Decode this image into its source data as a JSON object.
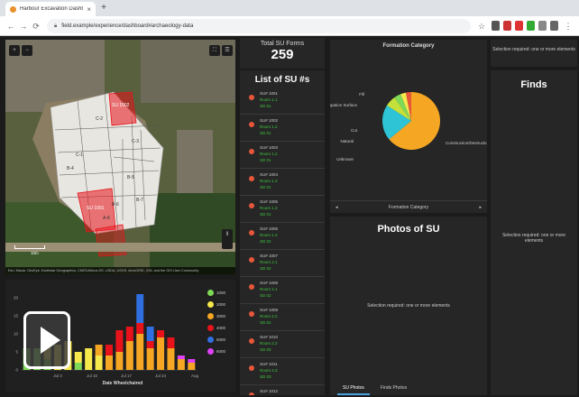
{
  "browser": {
    "tab_title": "Harbour Excavation Dashboard",
    "tab_close": "×",
    "new_tab": "+",
    "url": "field.example/experience/dashboard#archaeology-data",
    "back": "←",
    "forward": "→",
    "reload": "⟳",
    "star": "☆"
  },
  "map": {
    "zoom_in": "+",
    "zoom_out": "−",
    "layers": "☰",
    "attribution": "Esri, Maxar, GeoEye, Earthstar Geographics, CNES/Airbus DS, USDA, USGS, AeroGRID, IGN, and the GIS User Community",
    "scale_label": "10m",
    "polygon_labels": [
      "C-1",
      "C-2",
      "C-3",
      "B-4",
      "B-5",
      "B-6",
      "B-7",
      "A-8"
    ],
    "highlight_labels": [
      "SU 1001",
      "SU 1002"
    ]
  },
  "total": {
    "label": "Total SU Forms",
    "value": "259"
  },
  "su_list": {
    "title": "List of SU #s",
    "items": [
      {
        "su": "SU# 1001",
        "line1": "Room 1.1",
        "line2": "SD 01"
      },
      {
        "su": "SU# 1002",
        "line1": "Room 1.2",
        "line2": "SD 01"
      },
      {
        "su": "SU# 1003",
        "line1": "Room 1.2",
        "line2": "SD 01"
      },
      {
        "su": "SU# 1004",
        "line1": "Room 1.3",
        "line2": "SD 01"
      },
      {
        "su": "SU# 1005",
        "line1": "Room 1.3",
        "line2": "SD 01"
      },
      {
        "su": "SU# 1006",
        "line1": "Room 1.3",
        "line2": "SD 02"
      },
      {
        "su": "SU# 1007",
        "line1": "Room 2.1",
        "line2": "SD 02"
      },
      {
        "su": "SU# 1008",
        "line1": "Room 2.1",
        "line2": "SD 02"
      },
      {
        "su": "SU# 1009",
        "line1": "Room 2.2",
        "line2": "SD 02"
      },
      {
        "su": "SU# 1010",
        "line1": "Room 2.2",
        "line2": "SD 03"
      },
      {
        "su": "SU# 1011",
        "line1": "Room 2.3",
        "line2": "SD 03"
      },
      {
        "su": "SU# 1012",
        "line1": "Room 2.3",
        "line2": "SD 03"
      }
    ]
  },
  "pie": {
    "title": "Formation Category",
    "footer": "Formation Category",
    "prev": "◂",
    "next": "▸",
    "labels": [
      "Fill",
      "Occupation Surface",
      "Cut",
      "Natural",
      "Construction/Destruction",
      "Unknown"
    ],
    "slices": [
      {
        "name": "Construction/Destruction",
        "value": 64,
        "color": "#f5a623"
      },
      {
        "name": "Fill",
        "value": 20,
        "color": "#2ec4d6"
      },
      {
        "name": "Occupation Surface",
        "value": 6,
        "color": "#c6e03a"
      },
      {
        "name": "Cut",
        "value": 4,
        "color": "#7ed957"
      },
      {
        "name": "Natural",
        "value": 3,
        "color": "#f7e94b"
      },
      {
        "name": "Unknown",
        "value": 3,
        "color": "#e8563a"
      }
    ]
  },
  "photos": {
    "title": "Photos of SU",
    "message": "Selection required: one or more elements",
    "tabs": [
      "SU Photos",
      "Finds Photos"
    ]
  },
  "selection_top": {
    "message": "Selection required: one or more elements"
  },
  "finds": {
    "title": "Finds",
    "message": "Selection required: one or more elements"
  },
  "timechart": {
    "xlabel": "Date Wheelchaired",
    "xticks": [
      "Jul 3",
      "Jul 10",
      "Jul 17",
      "Jul 24",
      "Aug"
    ],
    "yticks": [
      "0",
      "5",
      "10",
      "15",
      "20"
    ],
    "legend": [
      {
        "label": "1000",
        "color": "#7ed957"
      },
      {
        "label": "2000",
        "color": "#f7e94b"
      },
      {
        "label": "3000",
        "color": "#f5a623"
      },
      {
        "label": "4000",
        "color": "#e8131a"
      },
      {
        "label": "5000",
        "color": "#2f6fe0"
      },
      {
        "label": "6000",
        "color": "#e040fb"
      }
    ]
  },
  "chart_data": {
    "type": "bar",
    "stacked": true,
    "xlabel": "Date Wheelchaired",
    "ylim": [
      0,
      22
    ],
    "series": [
      {
        "name": "1000",
        "values": [
          6,
          6,
          3,
          0,
          0,
          2,
          0,
          0,
          0,
          0,
          0,
          0,
          0,
          0,
          0,
          0,
          0
        ]
      },
      {
        "name": "2000",
        "values": [
          0,
          0,
          5,
          7,
          8,
          3,
          6,
          4,
          0,
          0,
          0,
          0,
          0,
          0,
          0,
          0,
          0
        ]
      },
      {
        "name": "3000",
        "values": [
          0,
          0,
          0,
          0,
          0,
          0,
          0,
          3,
          4,
          5,
          8,
          10,
          6,
          9,
          6,
          3,
          2
        ]
      },
      {
        "name": "4000",
        "values": [
          0,
          0,
          0,
          0,
          0,
          0,
          0,
          0,
          3,
          6,
          4,
          3,
          2,
          2,
          3,
          0,
          0
        ]
      },
      {
        "name": "5000",
        "values": [
          0,
          0,
          0,
          0,
          0,
          0,
          0,
          0,
          0,
          0,
          0,
          8,
          4,
          0,
          0,
          0,
          0
        ]
      },
      {
        "name": "6000",
        "values": [
          0,
          0,
          0,
          0,
          0,
          0,
          0,
          0,
          0,
          0,
          0,
          0,
          0,
          0,
          0,
          1,
          1
        ]
      }
    ]
  }
}
